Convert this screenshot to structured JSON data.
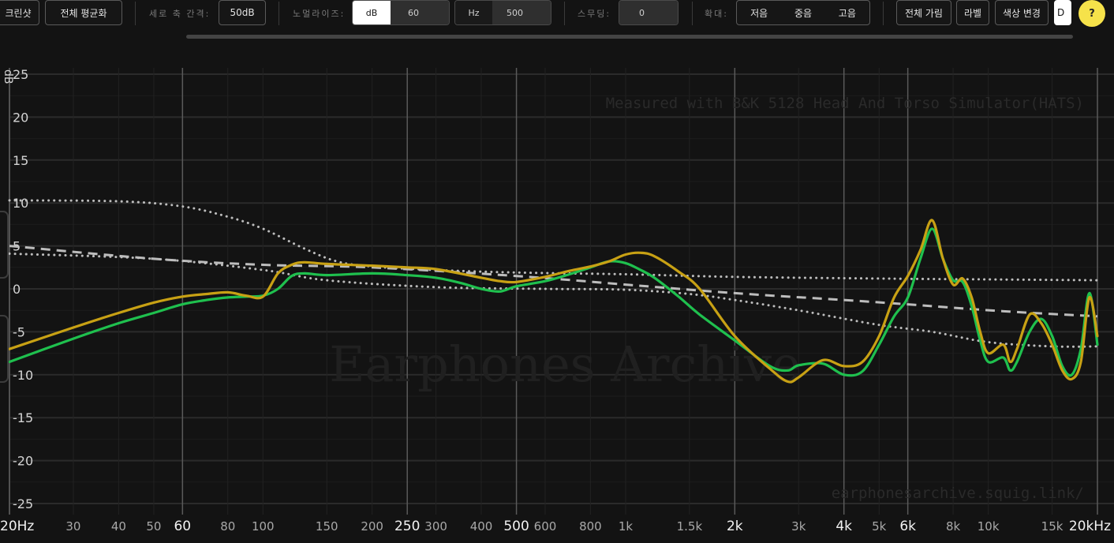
{
  "toolbar": {
    "screenshot_label": "크린샷",
    "normalize_all_label": "전체 평균화",
    "yaxis_interval_label": "세로 축 간격:",
    "yaxis_interval_value": "50dB",
    "normalize_label": "노멀라이즈:",
    "normalize_db_unit": "dB",
    "normalize_db_value": "60",
    "normalize_hz_unit": "Hz",
    "normalize_hz_value": "500",
    "smoothing_label": "스무딩:",
    "smoothing_value": "0",
    "zoom_label": "확대:",
    "zoom_low": "저음",
    "zoom_mid": "중음",
    "zoom_high": "고음",
    "hide_all_label": "전체 가림",
    "labels_label": "라벨",
    "change_color_label": "색상 변경",
    "cut_button_label": "D",
    "help_label": "?"
  },
  "colors": {
    "background": "#131313",
    "accent_yellow": "#f6e24a",
    "curve_gold": "#c8a114",
    "curve_green": "#1fc04e",
    "target_gray": "#bdbdbd"
  },
  "chart_data": {
    "type": "line",
    "xscale": "log",
    "xlim": [
      20,
      20000
    ],
    "ylim": [
      -25,
      25
    ],
    "yticks": [
      25,
      20,
      15,
      10,
      5,
      0,
      -5,
      -10,
      -15,
      -20,
      -25
    ],
    "ylabel_unit": "dB",
    "xticks": [
      {
        "v": 20,
        "label": "20Hz",
        "major": true
      },
      {
        "v": 30,
        "label": "30",
        "major": false
      },
      {
        "v": 40,
        "label": "40",
        "major": false
      },
      {
        "v": 50,
        "label": "50",
        "major": false
      },
      {
        "v": 60,
        "label": "60",
        "major": true
      },
      {
        "v": 80,
        "label": "80",
        "major": false
      },
      {
        "v": 100,
        "label": "100",
        "major": false
      },
      {
        "v": 150,
        "label": "150",
        "major": false
      },
      {
        "v": 200,
        "label": "200",
        "major": false
      },
      {
        "v": 250,
        "label": "250",
        "major": true
      },
      {
        "v": 300,
        "label": "300",
        "major": false
      },
      {
        "v": 400,
        "label": "400",
        "major": false
      },
      {
        "v": 500,
        "label": "500",
        "major": true
      },
      {
        "v": 600,
        "label": "600",
        "major": false
      },
      {
        "v": 800,
        "label": "800",
        "major": false
      },
      {
        "v": 1000,
        "label": "1k",
        "major": false
      },
      {
        "v": 1500,
        "label": "1.5k",
        "major": false
      },
      {
        "v": 2000,
        "label": "2k",
        "major": true
      },
      {
        "v": 3000,
        "label": "3k",
        "major": false
      },
      {
        "v": 4000,
        "label": "4k",
        "major": true
      },
      {
        "v": 5000,
        "label": "5k",
        "major": false
      },
      {
        "v": 6000,
        "label": "6k",
        "major": true
      },
      {
        "v": 8000,
        "label": "8k",
        "major": false
      },
      {
        "v": 10000,
        "label": "10k",
        "major": false
      },
      {
        "v": 15000,
        "label": "15k",
        "major": false
      },
      {
        "v": 20000,
        "label": "20kHz",
        "major": true
      }
    ],
    "watermark_title": "Earphones Archive",
    "annotation_top": "Measured with B&K 5128 Head And Torso Simulator(HATS)",
    "annotation_bottom": "earphonesarchive.squig.link/",
    "series": [
      {
        "color": "#c8a114",
        "style": "solid",
        "points": [
          [
            20,
            -7
          ],
          [
            30,
            -4.5
          ],
          [
            40,
            -2.8
          ],
          [
            50,
            -1.6
          ],
          [
            60,
            -0.9
          ],
          [
            70,
            -0.6
          ],
          [
            80,
            -0.4
          ],
          [
            90,
            -0.8
          ],
          [
            100,
            -0.9
          ],
          [
            110,
            1.8
          ],
          [
            120,
            2.8
          ],
          [
            130,
            3.1
          ],
          [
            150,
            2.9
          ],
          [
            200,
            2.7
          ],
          [
            250,
            2.5
          ],
          [
            300,
            2.3
          ],
          [
            400,
            1.3
          ],
          [
            450,
            0.9
          ],
          [
            500,
            0.8
          ],
          [
            600,
            1.4
          ],
          [
            700,
            2.1
          ],
          [
            800,
            2.6
          ],
          [
            900,
            3.2
          ],
          [
            1000,
            4.0
          ],
          [
            1100,
            4.2
          ],
          [
            1200,
            3.8
          ],
          [
            1400,
            2.0
          ],
          [
            1600,
            0.0
          ],
          [
            2000,
            -5.5
          ],
          [
            2500,
            -9.3
          ],
          [
            2800,
            -10.8
          ],
          [
            3000,
            -10.3
          ],
          [
            3500,
            -8.3
          ],
          [
            4000,
            -9.0
          ],
          [
            4500,
            -8.5
          ],
          [
            5000,
            -5.5
          ],
          [
            5500,
            -1.0
          ],
          [
            6000,
            1.5
          ],
          [
            6500,
            4.5
          ],
          [
            7000,
            8.0
          ],
          [
            7500,
            3.5
          ],
          [
            8000,
            0.5
          ],
          [
            8500,
            1.2
          ],
          [
            9000,
            -1.0
          ],
          [
            9500,
            -5.0
          ],
          [
            10000,
            -7.5
          ],
          [
            11000,
            -6.5
          ],
          [
            11500,
            -8.5
          ],
          [
            12000,
            -7.0
          ],
          [
            13000,
            -3.0
          ],
          [
            14000,
            -4.0
          ],
          [
            15000,
            -6.5
          ],
          [
            16000,
            -9.5
          ],
          [
            17000,
            -10.5
          ],
          [
            18000,
            -8.5
          ],
          [
            19000,
            -1.0
          ],
          [
            20000,
            -5.5
          ]
        ]
      },
      {
        "color": "#1fc04e",
        "style": "solid",
        "points": [
          [
            20,
            -8.5
          ],
          [
            30,
            -5.8
          ],
          [
            40,
            -4.0
          ],
          [
            50,
            -2.8
          ],
          [
            60,
            -1.8
          ],
          [
            70,
            -1.3
          ],
          [
            80,
            -1.0
          ],
          [
            90,
            -0.9
          ],
          [
            100,
            -0.8
          ],
          [
            110,
            0.0
          ],
          [
            120,
            1.5
          ],
          [
            130,
            1.8
          ],
          [
            150,
            1.6
          ],
          [
            200,
            1.8
          ],
          [
            250,
            1.6
          ],
          [
            300,
            1.3
          ],
          [
            350,
            0.7
          ],
          [
            400,
            0.0
          ],
          [
            450,
            -0.3
          ],
          [
            500,
            0.3
          ],
          [
            600,
            0.9
          ],
          [
            700,
            1.7
          ],
          [
            800,
            2.5
          ],
          [
            900,
            3.2
          ],
          [
            1000,
            3.0
          ],
          [
            1100,
            2.2
          ],
          [
            1200,
            1.3
          ],
          [
            1400,
            -0.9
          ],
          [
            1600,
            -3.0
          ],
          [
            2000,
            -6.0
          ],
          [
            2500,
            -9.0
          ],
          [
            2800,
            -9.5
          ],
          [
            3000,
            -8.9
          ],
          [
            3500,
            -8.7
          ],
          [
            4000,
            -10.0
          ],
          [
            4500,
            -9.6
          ],
          [
            5000,
            -6.5
          ],
          [
            5500,
            -3.2
          ],
          [
            6000,
            -1.0
          ],
          [
            6500,
            3.5
          ],
          [
            7000,
            7.0
          ],
          [
            7500,
            3.5
          ],
          [
            8000,
            1.0
          ],
          [
            8500,
            0.8
          ],
          [
            9000,
            -2.0
          ],
          [
            9500,
            -6.0
          ],
          [
            10000,
            -8.5
          ],
          [
            11000,
            -8.0
          ],
          [
            11500,
            -9.5
          ],
          [
            12000,
            -8.5
          ],
          [
            13000,
            -5.0
          ],
          [
            14000,
            -3.5
          ],
          [
            15000,
            -5.5
          ],
          [
            16000,
            -9.0
          ],
          [
            17000,
            -10.0
          ],
          [
            18000,
            -7.0
          ],
          [
            19000,
            -0.5
          ],
          [
            20000,
            -6.5
          ]
        ]
      },
      {
        "color": "#bdbdbd",
        "style": "dashed",
        "points": [
          [
            20,
            5.0
          ],
          [
            50,
            3.5
          ],
          [
            100,
            2.8
          ],
          [
            200,
            2.5
          ],
          [
            500,
            1.5
          ],
          [
            1000,
            0.5
          ],
          [
            2000,
            -0.5
          ],
          [
            4000,
            -1.3
          ],
          [
            6000,
            -1.8
          ],
          [
            8000,
            -2.2
          ],
          [
            12000,
            -2.7
          ],
          [
            20000,
            -3.2
          ]
        ]
      },
      {
        "color": "#bdbdbd",
        "style": "dotted",
        "points": [
          [
            20,
            10.3
          ],
          [
            40,
            10.2
          ],
          [
            60,
            9.6
          ],
          [
            80,
            8.4
          ],
          [
            100,
            7.0
          ],
          [
            130,
            4.7
          ],
          [
            160,
            3.2
          ],
          [
            200,
            2.6
          ],
          [
            300,
            2.2
          ],
          [
            500,
            1.9
          ],
          [
            1000,
            1.7
          ],
          [
            2000,
            1.4
          ],
          [
            5000,
            1.2
          ],
          [
            10000,
            1.1
          ],
          [
            20000,
            1.0
          ]
        ]
      },
      {
        "color": "#bdbdbd",
        "style": "dotted",
        "points": [
          [
            20,
            4.1
          ],
          [
            50,
            3.5
          ],
          [
            100,
            2.2
          ],
          [
            150,
            1.0
          ],
          [
            300,
            0.2
          ],
          [
            600,
            0.0
          ],
          [
            1000,
            -0.1
          ],
          [
            1500,
            -0.6
          ],
          [
            2000,
            -1.3
          ],
          [
            3000,
            -2.5
          ],
          [
            5000,
            -4.2
          ],
          [
            7000,
            -5.0
          ],
          [
            10000,
            -6.2
          ],
          [
            15000,
            -6.7
          ],
          [
            20000,
            -6.7
          ]
        ]
      }
    ]
  }
}
